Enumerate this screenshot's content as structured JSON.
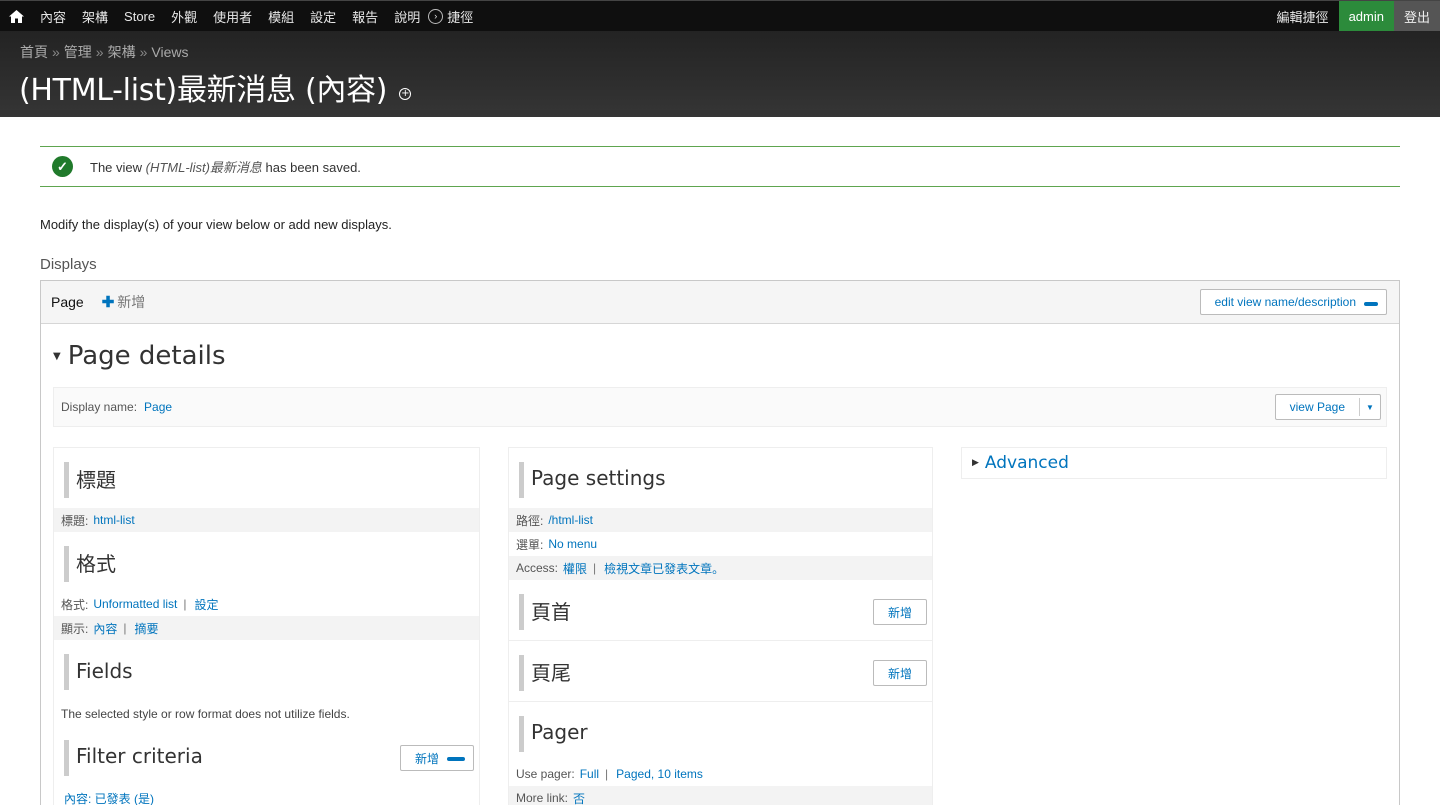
{
  "toolbar": {
    "menu": [
      "內容",
      "架構",
      "Store",
      "外觀",
      "使用者",
      "模組",
      "設定",
      "報告",
      "說明"
    ],
    "shortcuts": "捷徑",
    "edit_shortcuts": "編輯捷徑",
    "user": "admin",
    "logout": "登出"
  },
  "header": {
    "breadcrumb": [
      "首頁",
      "管理",
      "架構",
      "Views"
    ],
    "breadcrumb_sep": "»",
    "title": "(HTML-list)最新消息 (內容)"
  },
  "status": {
    "prefix": "The view ",
    "view_name": "(HTML-list)最新消息",
    "suffix": " has been saved."
  },
  "intro": "Modify the display(s) of your view below or add new displays.",
  "displays_label": "Displays",
  "tabs": {
    "active": "Page",
    "add": "新增",
    "edit_view_name": "edit view name/description"
  },
  "details": {
    "heading": "Page details",
    "display_name_label": "Display name:",
    "display_name_value": "Page",
    "view_page_btn": "view Page"
  },
  "col1": {
    "title_section": {
      "heading": "標題",
      "label": "標題:",
      "value": "html-list"
    },
    "format_section": {
      "heading": "格式",
      "format_label": "格式:",
      "format_value": "Unformatted list",
      "format_settings": "設定",
      "show_label": "顯示:",
      "show_value": "內容",
      "show_settings": "摘要"
    },
    "fields_section": {
      "heading": "Fields",
      "note": "The selected style or row format does not utilize fields."
    },
    "filter_section": {
      "heading": "Filter criteria",
      "add": "新增",
      "item": "內容: 已發表 (是)"
    }
  },
  "col2": {
    "page_settings": {
      "heading": "Page settings",
      "path_label": "路徑:",
      "path_value": "/html-list",
      "menu_label": "選單:",
      "menu_value": "No menu",
      "access_label": "Access:",
      "access_value": "權限",
      "access_detail": "檢視文章已發表文章。"
    },
    "header_section": {
      "heading": "頁首",
      "add": "新增"
    },
    "footer_section": {
      "heading": "頁尾",
      "add": "新增"
    },
    "pager_section": {
      "heading": "Pager",
      "use_pager_label": "Use pager:",
      "use_pager_value": "Full",
      "use_pager_detail": "Paged, 10 items",
      "more_link_label": "More link:",
      "more_link_value": "否"
    }
  },
  "col3": {
    "advanced": "Advanced"
  },
  "colors": {
    "link": "#0074bd",
    "status_green": "#207a2b",
    "user_green": "#2c8b3b",
    "toolbar_bg": "#0f0f0f"
  }
}
